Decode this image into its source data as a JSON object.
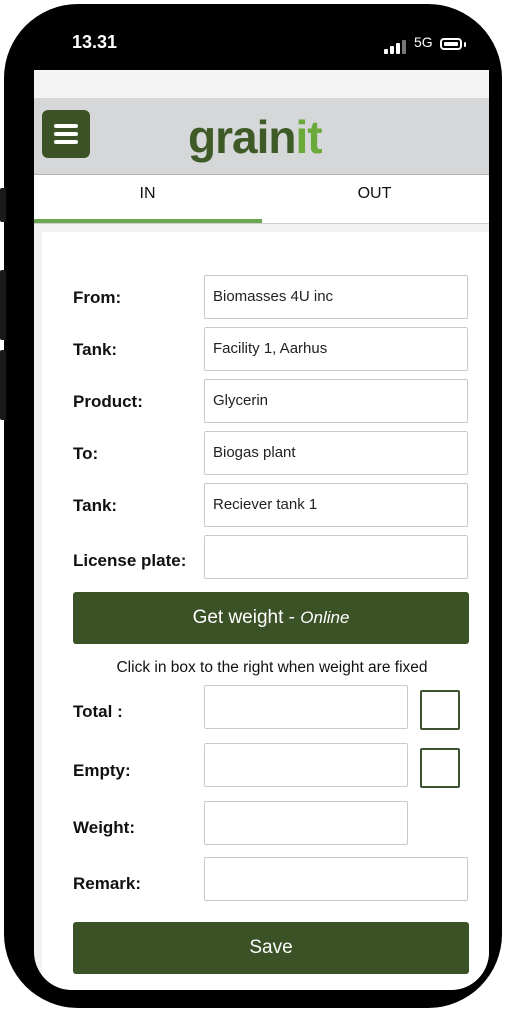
{
  "status_bar": {
    "time": "13.31",
    "network": "5G"
  },
  "header": {
    "app_name_part1": "gra",
    "app_name_part2": "in",
    "app_name_part3": "it"
  },
  "tabs": [
    {
      "label": "IN",
      "selected": true
    },
    {
      "label": "OUT",
      "selected": false
    }
  ],
  "form": {
    "from": {
      "label": "From:",
      "value": "Biomasses 4U inc"
    },
    "tank_from": {
      "label": "Tank:",
      "value": "Facility 1, Aarhus"
    },
    "product": {
      "label": "Product:",
      "value": "Glycerin"
    },
    "to": {
      "label": "To:",
      "value": "Biogas plant"
    },
    "tank_to": {
      "label": "Tank:",
      "value": "Reciever tank 1"
    },
    "license_plate": {
      "label": "License plate:",
      "value": ""
    }
  },
  "get_weight_button": {
    "label": "Get weight - ",
    "status": "Online"
  },
  "hint": "Click in box to the right when weight are fixed",
  "weights": {
    "total": {
      "label": "Total :",
      "value": ""
    },
    "empty": {
      "label": "Empty:",
      "value": ""
    },
    "weight": {
      "label": "Weight:",
      "value": ""
    },
    "remark": {
      "label": "Remark:",
      "value": ""
    }
  },
  "save_button": {
    "label": "Save"
  },
  "colors": {
    "brand_dark": "#3b5126",
    "brand_light": "#6aaa3a",
    "tab_indicator": "#6aa84f"
  }
}
